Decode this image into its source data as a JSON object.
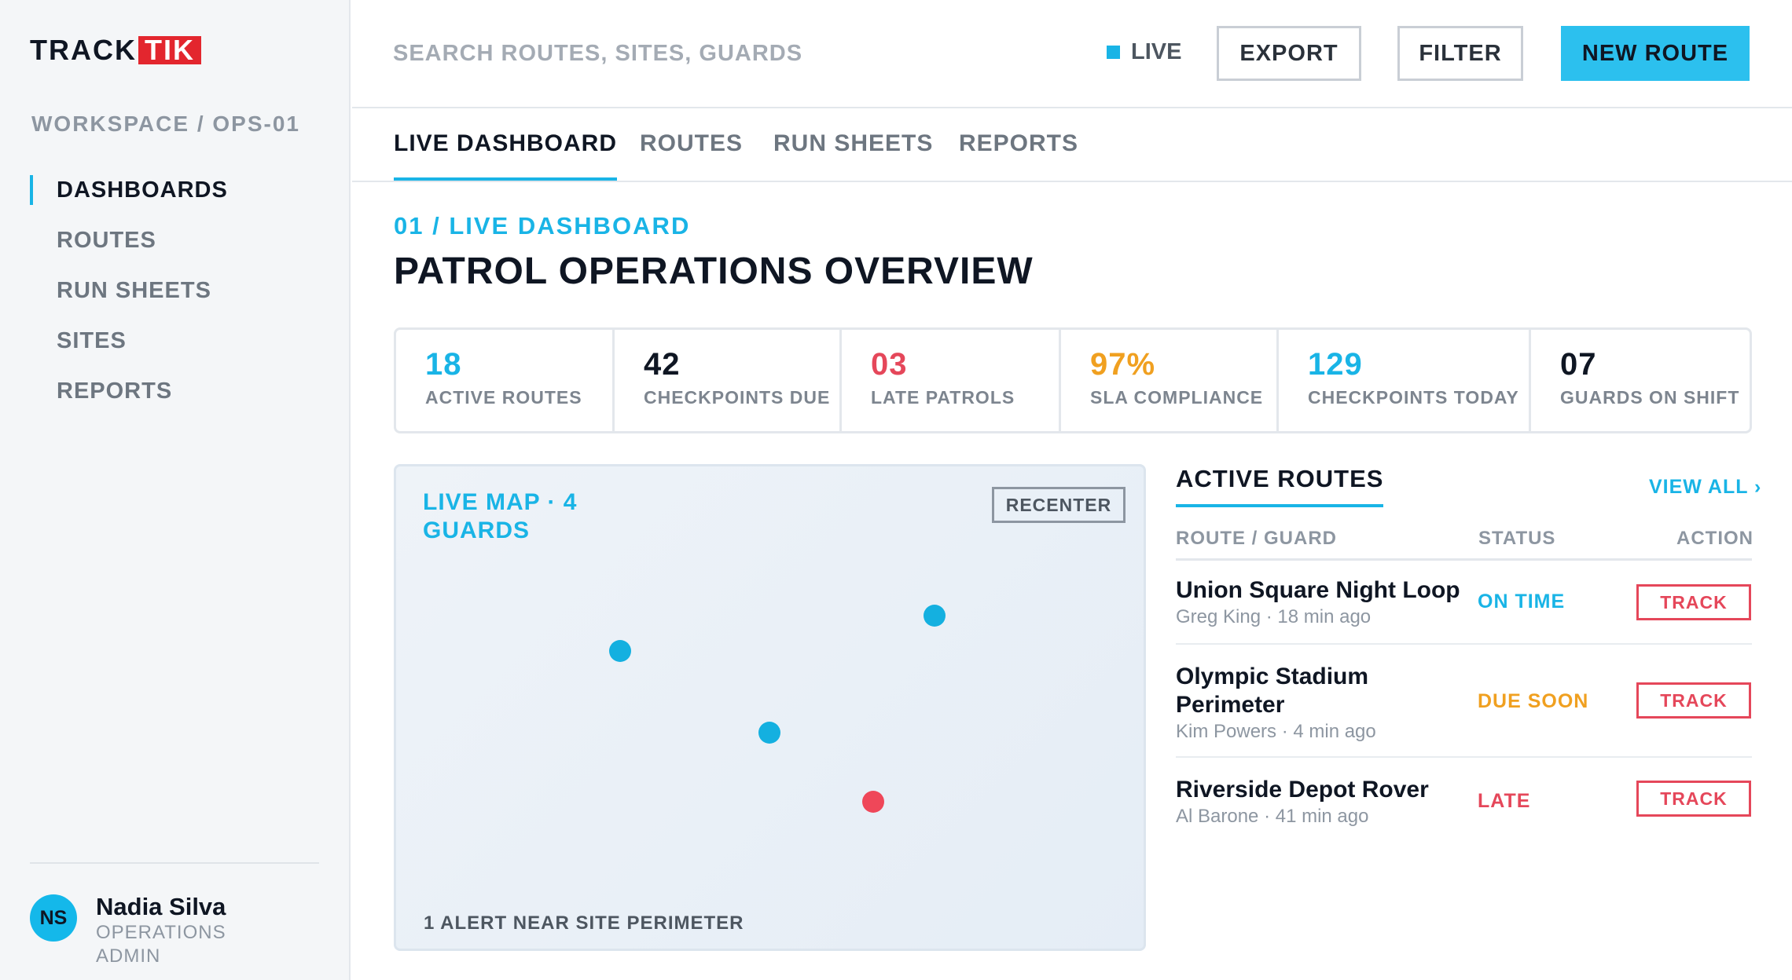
{
  "brand": {
    "logo_a": "TRACK",
    "logo_b": "TIK"
  },
  "sidebar": {
    "workspace": "WORKSPACE / OPS-01",
    "items": [
      {
        "label": "DASHBOARDS",
        "active": true
      },
      {
        "label": "ROUTES"
      },
      {
        "label": "RUN SHEETS"
      },
      {
        "label": "SITES"
      },
      {
        "label": "REPORTS"
      }
    ],
    "user": {
      "initials": "NS",
      "name": "Nadia Silva",
      "role": "OPERATIONS ADMIN"
    }
  },
  "topbar": {
    "search_placeholder": "SEARCH ROUTES, SITES, GUARDS",
    "live_label": "LIVE",
    "export_label": "EXPORT",
    "filter_label": "FILTER",
    "new_route_label": "NEW ROUTE"
  },
  "tabs": [
    "LIVE DASHBOARD",
    "ROUTES",
    "RUN SHEETS",
    "REPORTS"
  ],
  "header": {
    "breadcrumb": "01 / LIVE DASHBOARD",
    "title": "PATROL OPERATIONS OVERVIEW"
  },
  "stats": [
    {
      "value": "18",
      "label": "ACTIVE ROUTES",
      "color": "#19b4e6"
    },
    {
      "value": "42",
      "label": "CHECKPOINTS DUE",
      "color": "#0f1623"
    },
    {
      "value": "03",
      "label": "LATE PATROLS",
      "color": "#e5475a"
    },
    {
      "value": "97%",
      "label": "SLA COMPLIANCE",
      "color": "#f0a020"
    },
    {
      "value": "129",
      "label": "CHECKPOINTS TODAY",
      "color": "#19b4e6"
    },
    {
      "value": "07",
      "label": "GUARDS ON SHIFT",
      "color": "#0f1623"
    }
  ],
  "map": {
    "title": "LIVE MAP · 4 GUARDS",
    "recenter_label": "RECENTER",
    "alert_text": "1 ALERT NEAR SITE PERIMETER",
    "guard_color": "#14b0e0",
    "alert_color": "#ef4759"
  },
  "routes": {
    "title": "ACTIVE ROUTES",
    "view_all": "VIEW ALL ›",
    "columns": [
      "ROUTE / GUARD",
      "STATUS",
      "ACTION"
    ],
    "rows": [
      {
        "name": "Union Square Night Loop",
        "meta": "Greg King · 18 min ago",
        "status": "ON TIME",
        "status_color": "#19b4e6",
        "action": "TRACK"
      },
      {
        "name": "Olympic Stadium Perimeter",
        "meta": "Kim Powers · 4 min ago",
        "status": "DUE SOON",
        "status_color": "#f0a020",
        "action": "TRACK"
      },
      {
        "name": "Riverside Depot Rover",
        "meta": "Al Barone · 41 min ago",
        "status": "LATE",
        "status_color": "#e5475a",
        "action": "TRACK"
      }
    ]
  }
}
